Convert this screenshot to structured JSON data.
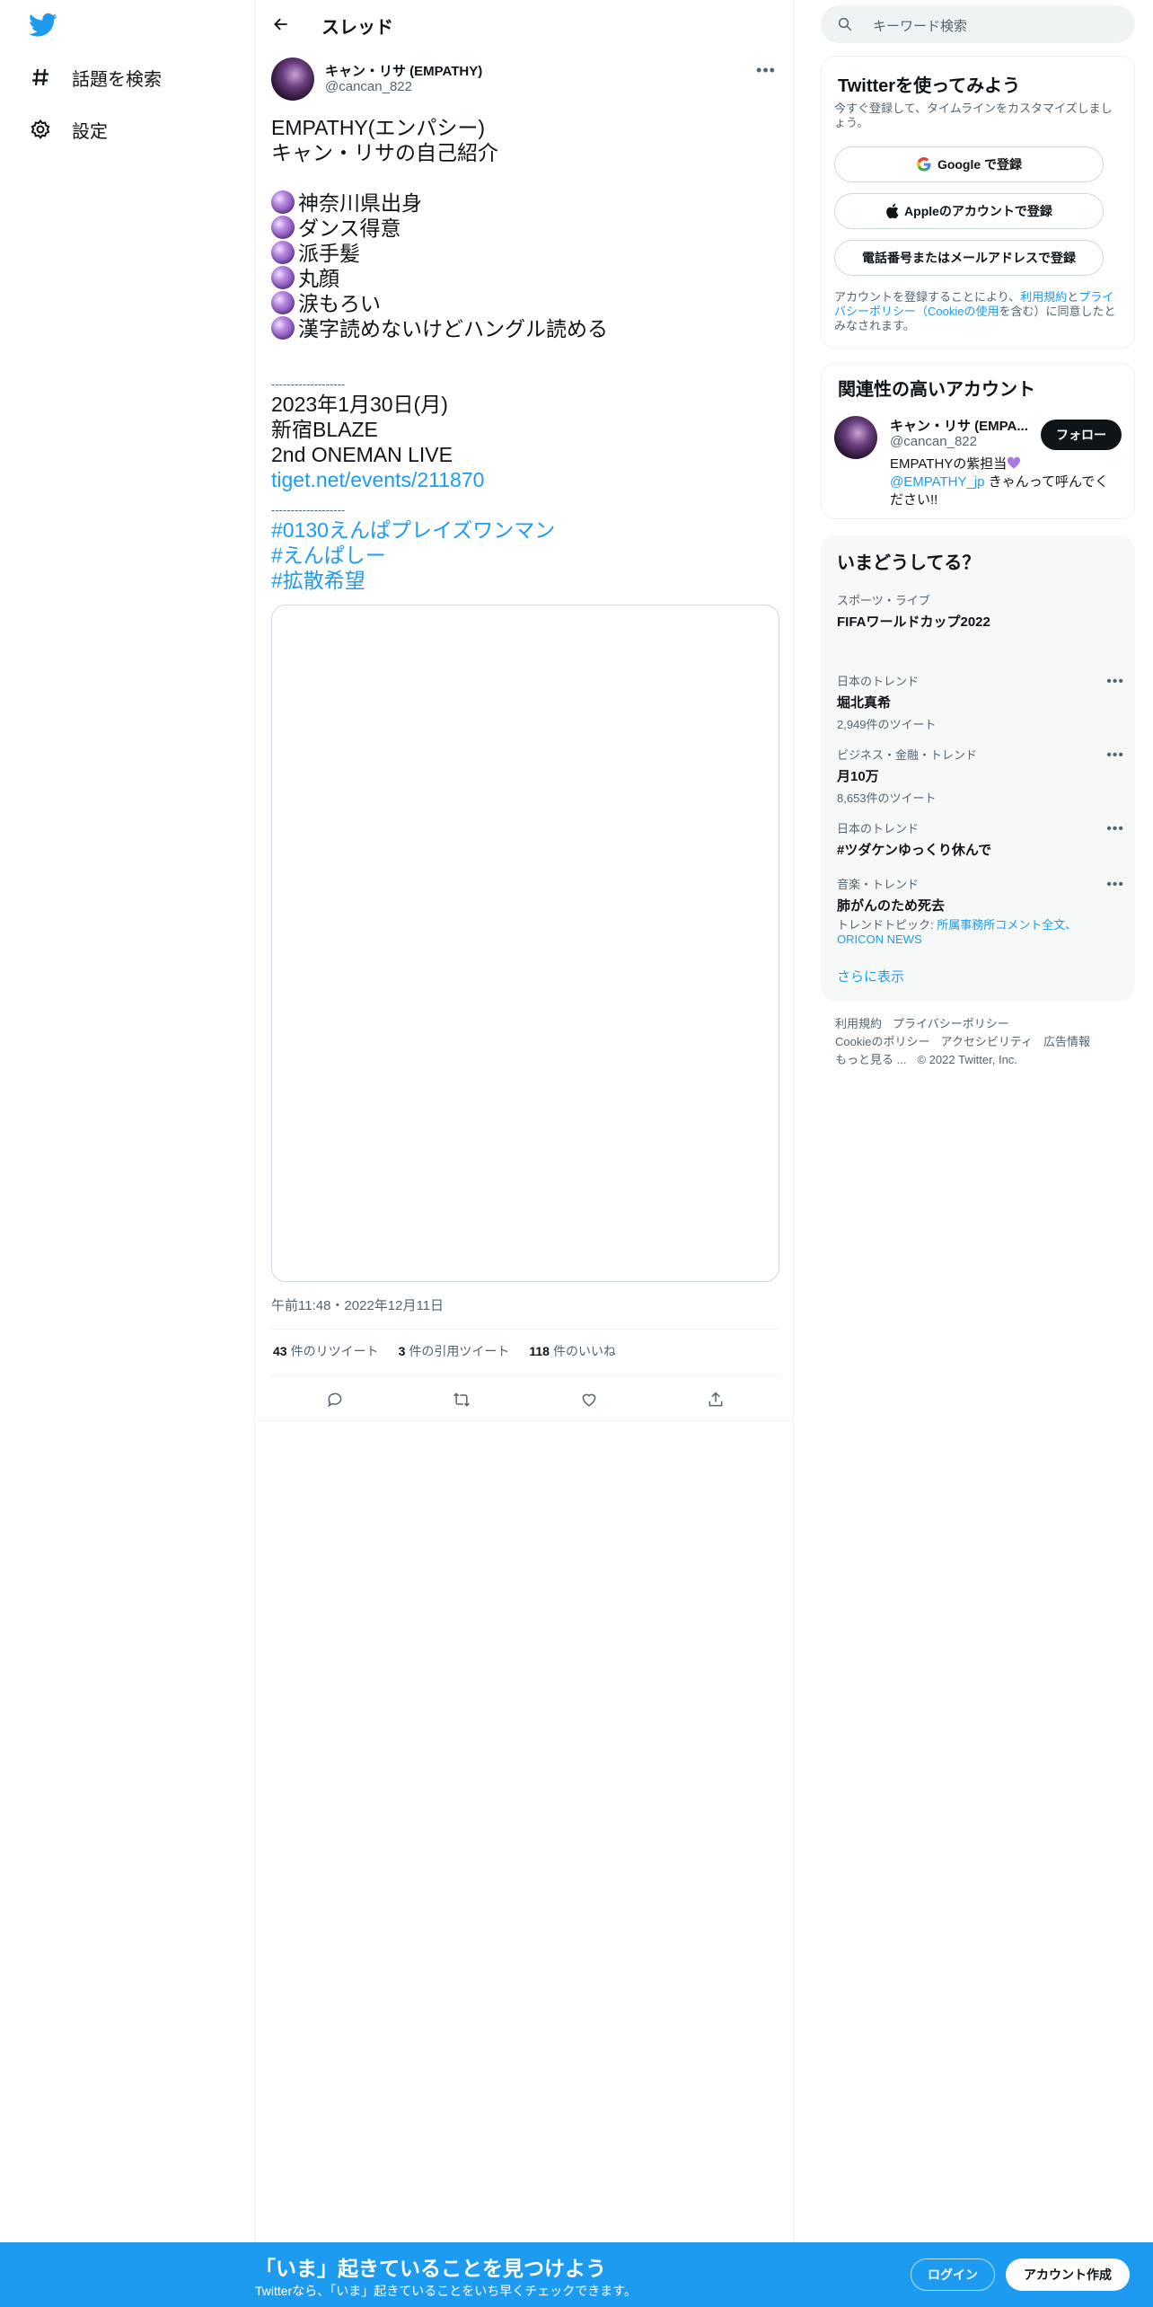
{
  "nav": {
    "items": [
      {
        "label": "話題を検索",
        "icon": "hashtag-icon"
      },
      {
        "label": "設定",
        "icon": "gear-icon"
      }
    ]
  },
  "thread": {
    "header_title": "スレッド"
  },
  "tweet": {
    "author_name": "キャン・リサ (EMPATHY)",
    "author_handle": "@cancan_822",
    "text": {
      "line1": "EMPATHY(エンパシー)",
      "line2": "キャン・リサの自己紹介",
      "bullets": [
        "神奈川県出身",
        "ダンス得意",
        "派手髪",
        "丸顔",
        "涙もろい",
        "漢字読めないけどハングル読める"
      ],
      "divider": "-------------------",
      "date": "2023年1月30日(月)",
      "venue": "新宿BLAZE",
      "event": "2nd ONEMAN LIVE",
      "url": "tiget.net/events/211870",
      "divider2": "-------------------",
      "hashtags": [
        "#0130えんぱプレイズワンマン",
        "#えんぱしー",
        "#拡散希望"
      ]
    },
    "timestamp": "午前11:48・2022年12月11日",
    "stats": [
      {
        "count": "43",
        "label": "件のリツイート"
      },
      {
        "count": "3",
        "label": "件の引用ツイート"
      },
      {
        "count": "118",
        "label": "件のいいね"
      }
    ]
  },
  "search": {
    "placeholder": "キーワード検索"
  },
  "signup_card": {
    "title": "Twitterを使ってみよう",
    "subtitle": "今すぐ登録して、タイムラインをカスタマイズしましょう。",
    "google_btn": "Google で登録",
    "apple_btn": "Appleのアカウントで登録",
    "phone_btn": "電話番号またはメールアドレスで登録",
    "legal_prefix": "アカウントを登録することにより、",
    "legal_terms": "利用規約",
    "legal_and": "と",
    "legal_privacy": "プライバシーポリシー（Cookieの使用",
    "legal_suffix": "を含む）に同意したとみなされます。"
  },
  "related": {
    "title": "関連性の高いアカウント",
    "name": "キャン・リサ (EMPA...",
    "handle": "@cancan_822",
    "follow_btn": "フォロー",
    "bio_part1": "EMPATHYの紫担当",
    "bio_mention": "@EMPATHY_jp",
    "bio_part2": " きゃんって呼んでください!!"
  },
  "trends": {
    "title": "いまどうしてる？",
    "items": [
      {
        "category": "スポーツ・ライブ",
        "name": "FIFAワールドカップ2022",
        "count": ""
      },
      {
        "category": "日本のトレンド",
        "name": "堀北真希",
        "count": "2,949件のツイート"
      },
      {
        "category": "ビジネス・金融・トレンド",
        "name": "月10万",
        "count": "8,653件のツイート"
      },
      {
        "category": "日本のトレンド",
        "name": "#ツダケンゆっくり休んで",
        "count": ""
      },
      {
        "category": "音楽・トレンド",
        "name": "肺がんのため死去",
        "count": ""
      }
    ],
    "topic_prefix": "トレンドトピック: ",
    "topic_link1": "所属事務所コメント全文",
    "topic_sep": "、",
    "topic_link2": "ORICON NEWS",
    "show_more": "さらに表示"
  },
  "footer": {
    "terms": "利用規約",
    "privacy": "プライバシーポリシー",
    "cookie": "Cookieのポリシー",
    "accessibility": "アクセシビリティ",
    "ads": "広告情報",
    "more": "もっと見る ...",
    "copyright": "© 2022 Twitter, Inc."
  },
  "bottom_bar": {
    "title": "「いま」起きていることを見つけよう",
    "subtitle": "Twitterなら、「いま」起きていることをいち早くチェックできます。",
    "login": "ログイン",
    "signup": "アカウント作成"
  },
  "colors": {
    "accent": "#1d9bf0",
    "text": "#0f1419",
    "muted": "#536471"
  }
}
